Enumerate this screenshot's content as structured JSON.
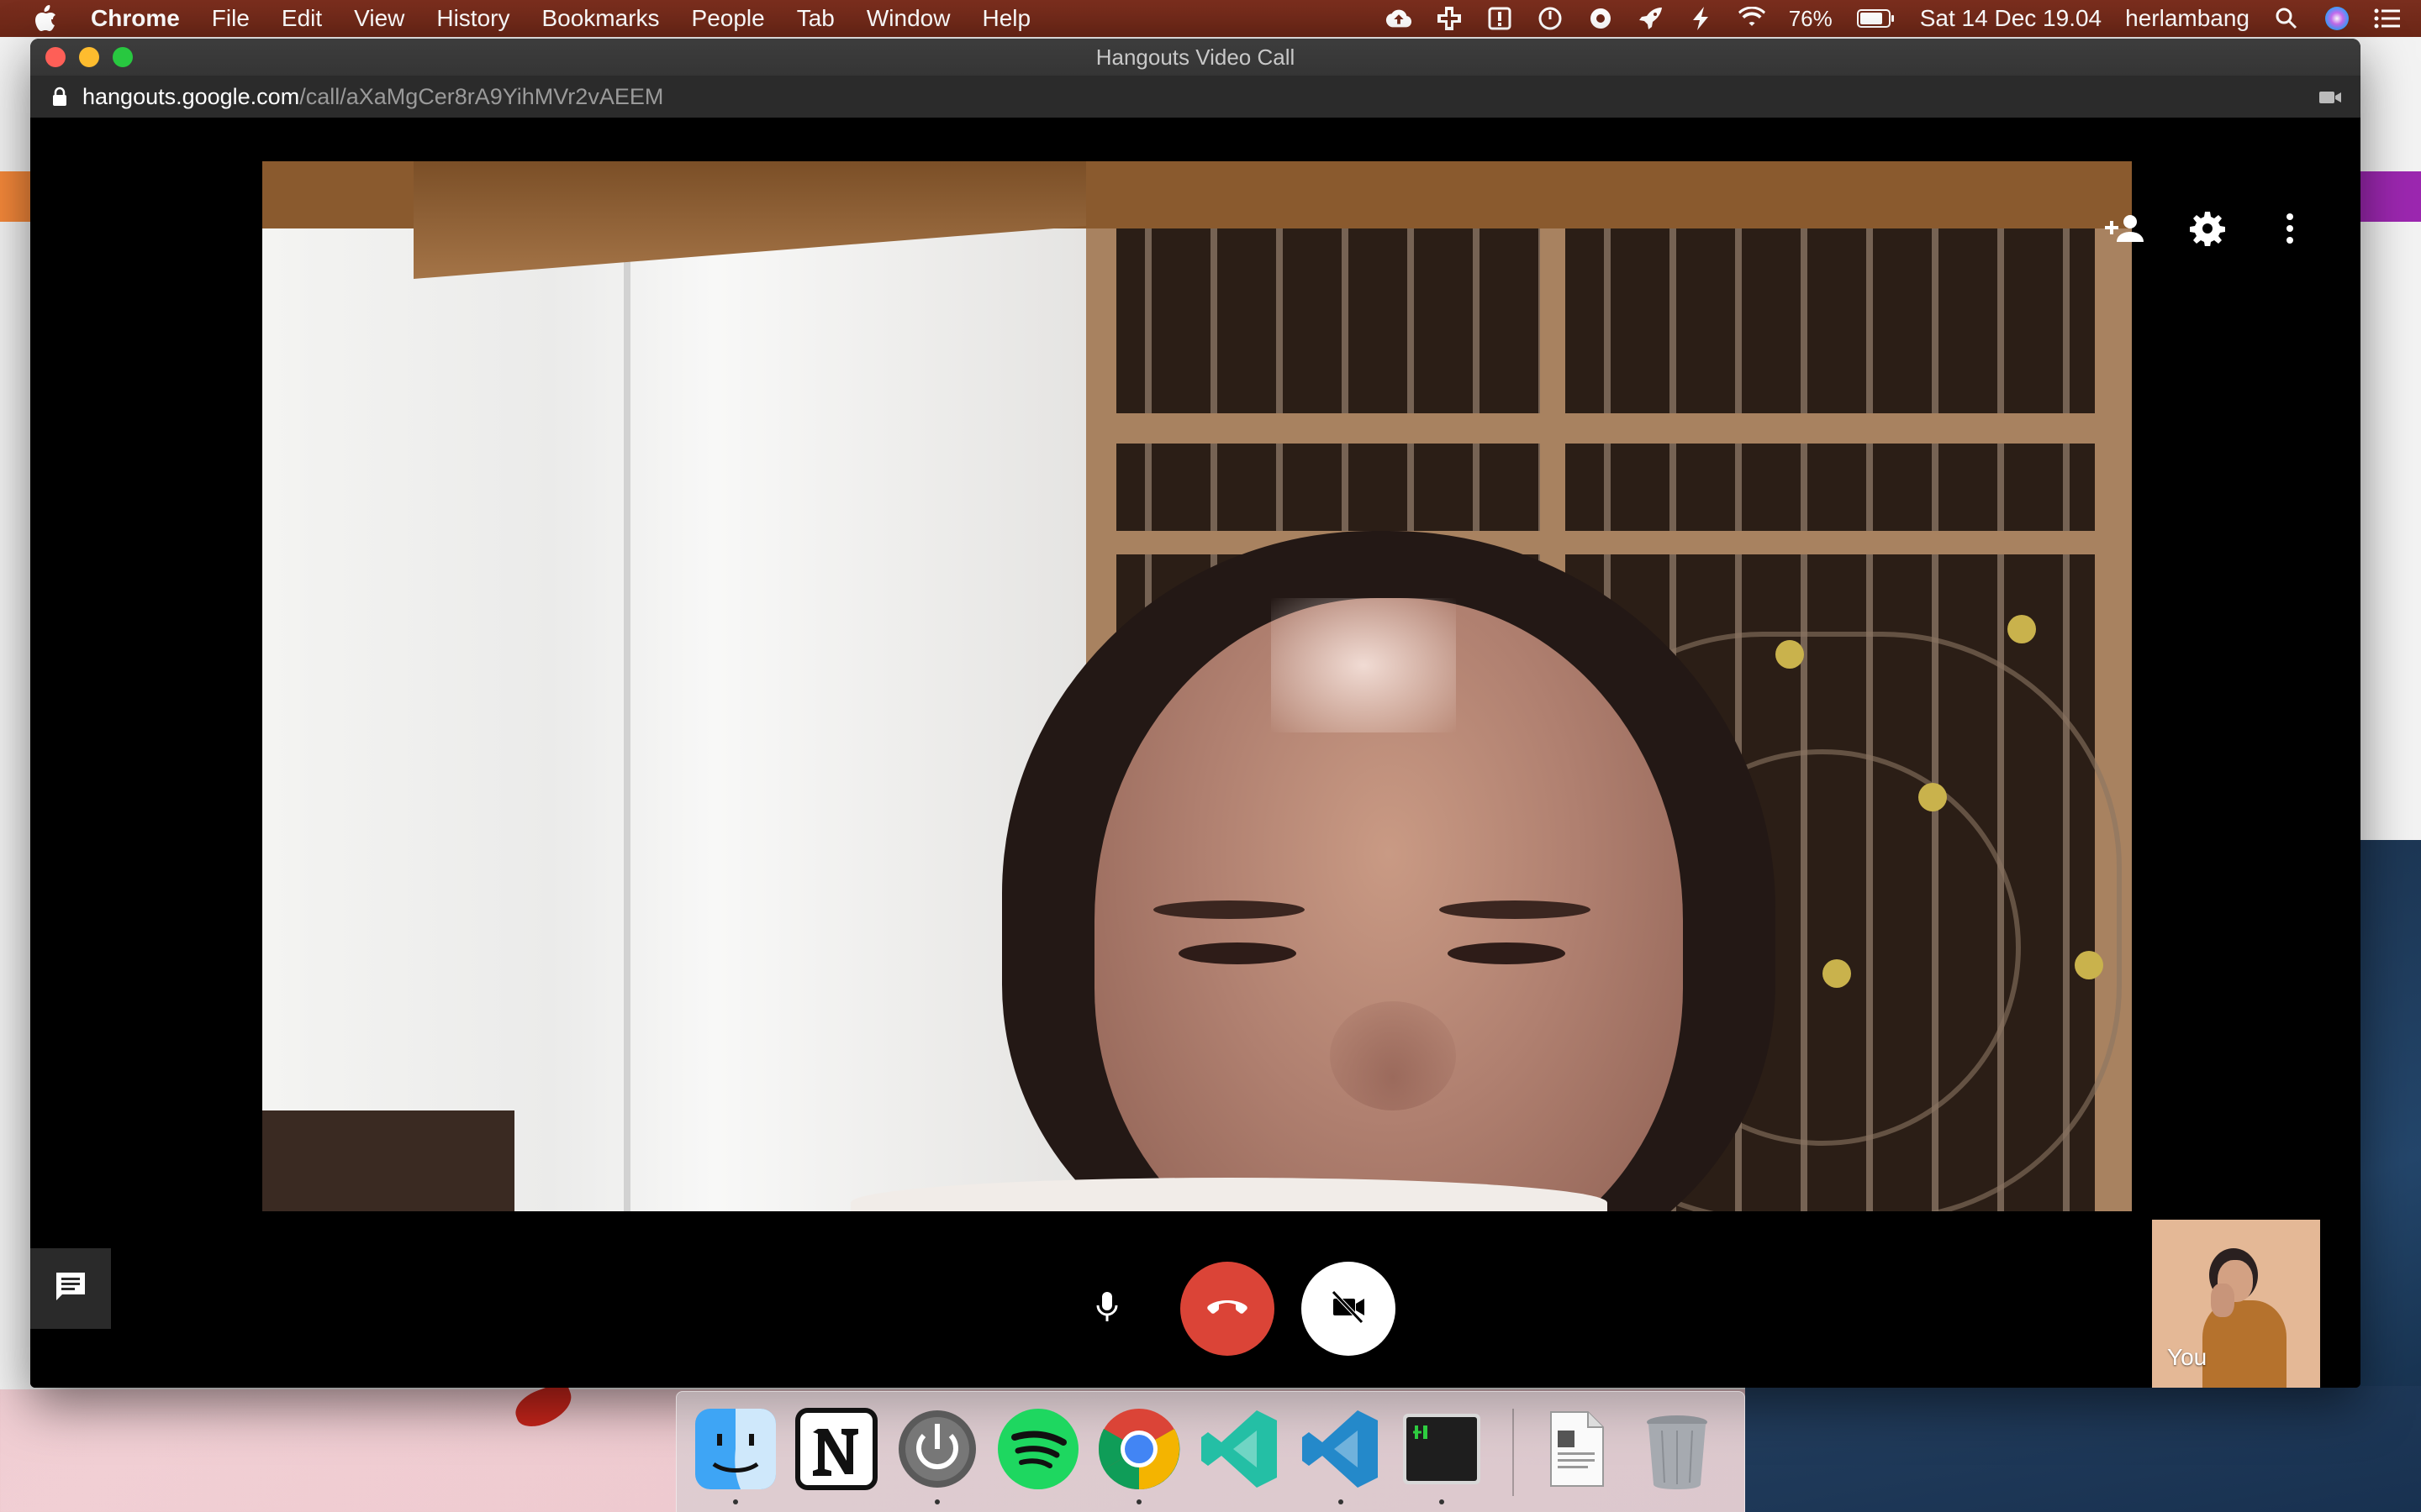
{
  "menubar": {
    "app_name": "Chrome",
    "menus": [
      "File",
      "Edit",
      "View",
      "History",
      "Bookmarks",
      "People",
      "Tab",
      "Window",
      "Help"
    ],
    "battery": "76%",
    "datetime": "Sat 14 Dec 19.04",
    "username": "herlambang"
  },
  "window": {
    "title": "Hangouts Video Call",
    "url_host": "hangouts.google.com",
    "url_path": "/call/aXaMgCer8rA9YihMVr2vAEEM"
  },
  "call": {
    "self_label": "You",
    "hangup_color": "#db4437"
  },
  "dock": {
    "apps": [
      "finder",
      "notion",
      "power",
      "spotify",
      "chrome",
      "vscode-insiders",
      "vscode",
      "terminal",
      "preview-document",
      "trash"
    ]
  }
}
